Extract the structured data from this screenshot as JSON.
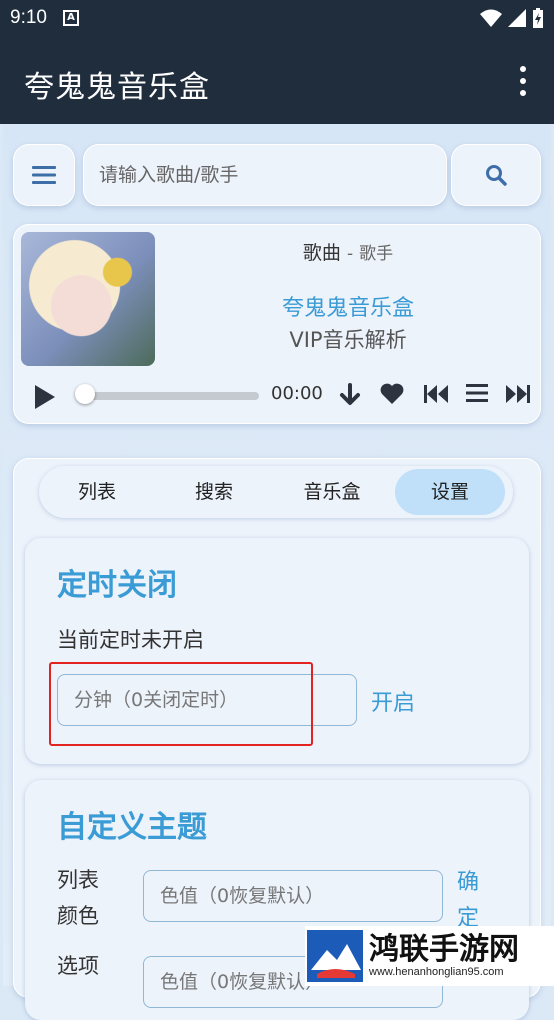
{
  "status_bar": {
    "time": "9:10",
    "notification_icon": "A"
  },
  "app_bar": {
    "title": "夸鬼鬼音乐盒",
    "menu_icon": "more-vert-icon"
  },
  "search": {
    "placeholder": "请输入歌曲/歌手"
  },
  "player": {
    "song": "歌曲",
    "separator": "-",
    "artist": "歌手",
    "lyric_line1": "夸鬼鬼音乐盒",
    "lyric_line2": "VIP音乐解析",
    "time": "00:00",
    "progress": 0
  },
  "tabs": [
    {
      "label": "列表"
    },
    {
      "label": "搜索"
    },
    {
      "label": "音乐盒"
    },
    {
      "label": "设置",
      "active": true
    }
  ],
  "timer": {
    "title": "定时关闭",
    "status": "当前定时未开启",
    "placeholder": "分钟（0关闭定时）",
    "button": "开启"
  },
  "theme": {
    "title": "自定义主题",
    "list_color_label_1": "列表",
    "list_color_label_2": "颜色",
    "list_color_placeholder": "色值（0恢复默认）",
    "confirm_1": "确",
    "confirm_2": "定",
    "option_label": "选项",
    "option_placeholder": "色值（0恢复默认）"
  },
  "watermark": {
    "title": "鸿联手游网",
    "url": "www.henanhonglian95.com"
  },
  "colors": {
    "accent": "#3a9bd5",
    "app_bar": "#1f2d3d",
    "active_tab": "#bfe0f8",
    "highlight_frame": "#e32222"
  }
}
